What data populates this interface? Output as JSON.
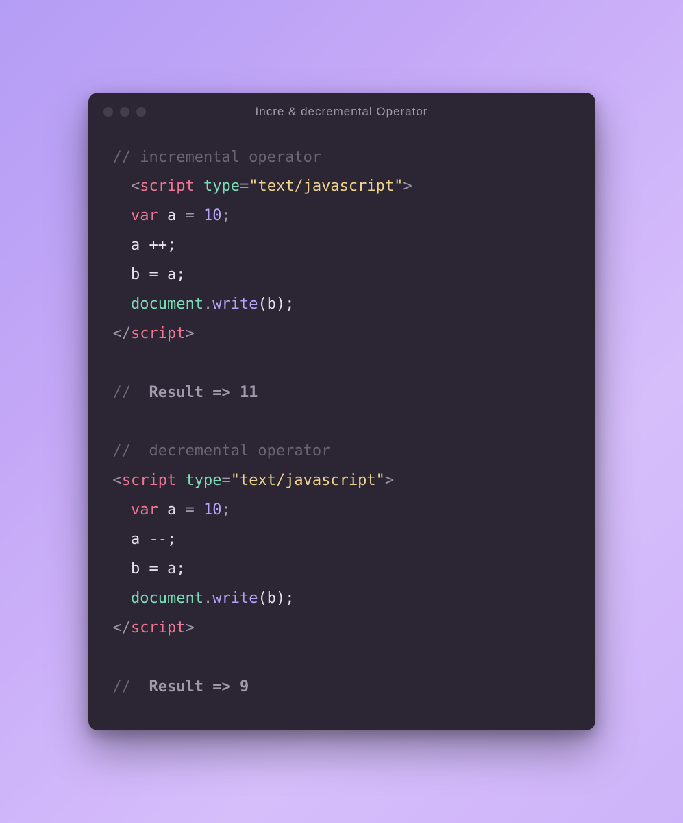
{
  "window": {
    "title": "Incre & decremental Operator"
  },
  "code": {
    "comment1": "// incremental operator",
    "scriptOpen1_lt": "<",
    "scriptOpen1_name": "script",
    "scriptOpen1_attr": "type",
    "scriptOpen1_eq": "=",
    "scriptOpen1_val": "\"text/javascript\"",
    "scriptOpen1_gt": ">",
    "kw_var1": "var",
    "var_a1": " a ",
    "eq1": "=",
    "sp1": " ",
    "num10_1": "10",
    "semi1": ";",
    "line_app": "  a ++;",
    "line_ba1": "  b = a;",
    "doc1": "document",
    "dot1": ".",
    "write1": "write",
    "call1": "(b);",
    "scriptClose1": "</",
    "scriptClose1_name": "script",
    "scriptClose1_gt": ">",
    "result1_slashes": "//",
    "result1_label": "  Result => 11",
    "comment2_slashes": "//",
    "comment2_text": "  decremental operator",
    "scriptOpen2_lt": "<",
    "scriptOpen2_name": "script",
    "scriptOpen2_attr": "type",
    "scriptOpen2_eq": "=",
    "scriptOpen2_val": "\"text/javascript\"",
    "scriptOpen2_gt": ">",
    "kw_var2": "var",
    "var_a2": " a ",
    "eq2": "=",
    "sp2": " ",
    "num10_2": "10",
    "semi2": ";",
    "line_amm": "  a --;",
    "line_ba2": "  b = a;",
    "doc2": "document",
    "dot2": ".",
    "write2": "write",
    "call2": "(b);",
    "scriptClose2": "</",
    "scriptClose2_name": "script",
    "scriptClose2_gt": ">",
    "result2_slashes": "//",
    "result2_label": "  Result => 9"
  }
}
